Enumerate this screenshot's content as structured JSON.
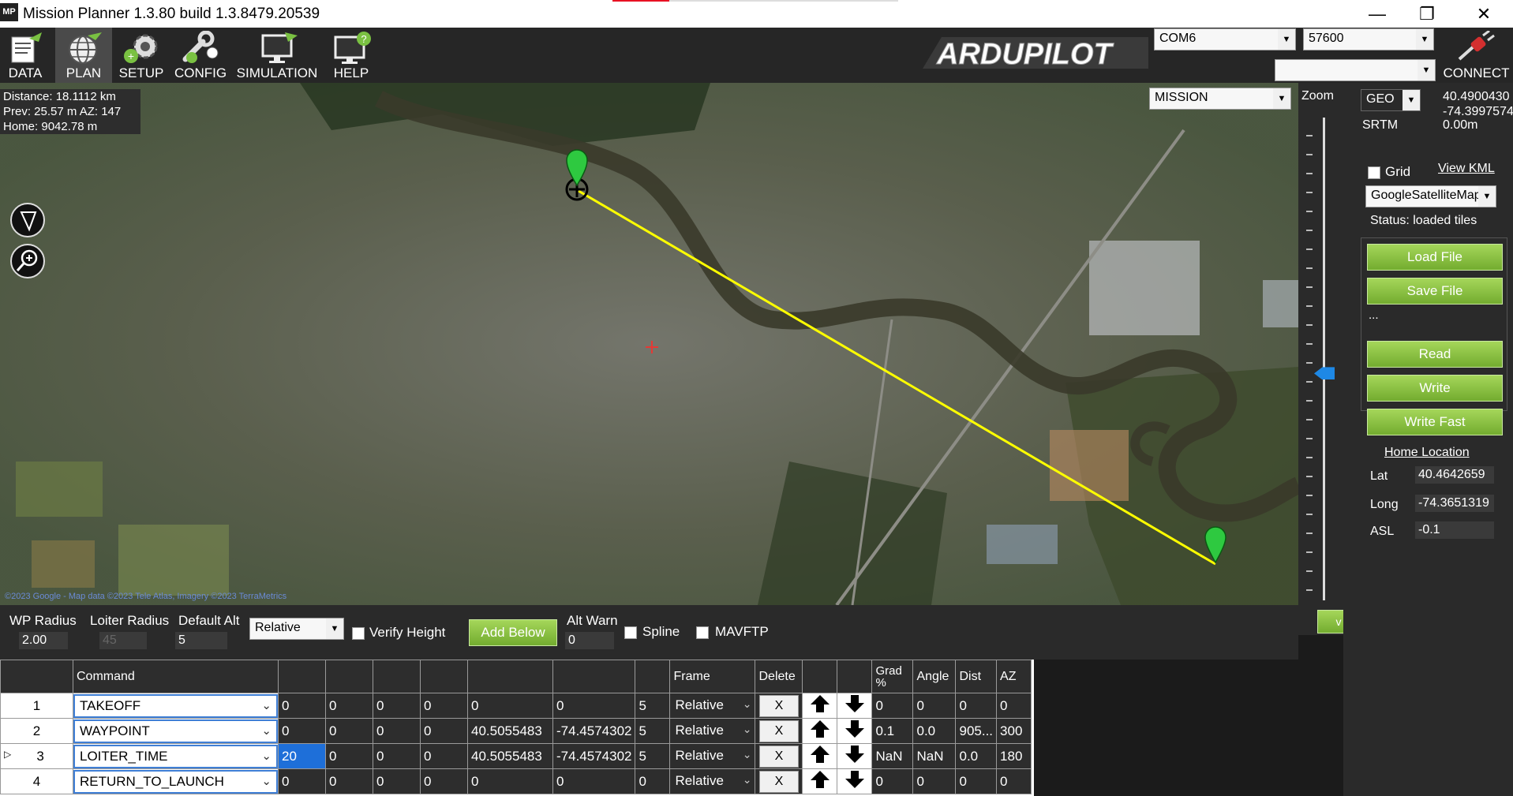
{
  "window": {
    "title": "Mission Planner 1.3.80 build 1.3.8479.20539",
    "app_icon": "MP",
    "controls": {
      "minimize": "—",
      "restore": "❐",
      "close": "✕"
    }
  },
  "toolbar": {
    "items": [
      {
        "label": "DATA",
        "icon": "data-icon"
      },
      {
        "label": "PLAN",
        "icon": "globe-icon",
        "active": true
      },
      {
        "label": "SETUP",
        "icon": "setup-gear-icon"
      },
      {
        "label": "CONFIG",
        "icon": "wrench-icon"
      },
      {
        "label": "SIMULATION",
        "icon": "monitor-plane-icon"
      },
      {
        "label": "HELP",
        "icon": "monitor-help-icon"
      }
    ],
    "logo_text": "ARDUPILOT",
    "port": "COM6",
    "baud": "57600",
    "link_combo": "",
    "connect_label": "CONNECT"
  },
  "map": {
    "info": {
      "distance": "Distance: 18.1112 km",
      "prev": "Prev: 25.57 m AZ: 147",
      "home": "Home: 9042.78 m"
    },
    "mode_combo": "MISSION",
    "attribution": "©2023 Google - Map data ©2023 Tele Atlas, Imagery ©2023 TerraMetrics"
  },
  "zoom": {
    "label": "Zoom",
    "level_fraction": 0.47,
    "collapse_button": "v"
  },
  "right": {
    "coord_mode": "GEO",
    "lat_readout": "40.4900430",
    "lng_readout": "-74.3997574",
    "srtm_label": "SRTM",
    "srtm_value": "0.00m",
    "grid_label": "Grid",
    "view_kml": "View KML",
    "map_type": "GoogleSatelliteMap",
    "status": "Status: loaded tiles",
    "load_file": "Load File",
    "save_file": "Save File",
    "ellipsis": "...",
    "read": "Read",
    "write": "Write",
    "write_fast": "Write Fast",
    "home_location": "Home Location",
    "lat_label": "Lat",
    "lat_value": "40.4642659",
    "long_label": "Long",
    "long_value": "-74.3651319",
    "asl_label": "ASL",
    "asl_value": "-0.1"
  },
  "options": {
    "wp_radius_label": "WP Radius",
    "wp_radius": "2.00",
    "loiter_radius_label": "Loiter Radius",
    "loiter_radius": "45",
    "default_alt_label": "Default Alt",
    "default_alt": "5",
    "alt_frame": "Relative",
    "verify_height": "Verify Height",
    "add_below": "Add Below",
    "alt_warn_label": "Alt Warn",
    "alt_warn": "0",
    "spline": "Spline",
    "mavftp": "MAVFTP"
  },
  "table": {
    "headers": {
      "command": "Command",
      "frame": "Frame",
      "delete": "Delete",
      "grad": "Grad %",
      "angle": "Angle",
      "dist": "Dist",
      "az": "AZ"
    },
    "rows": [
      {
        "num": "1",
        "command": "TAKEOFF",
        "p1": "0",
        "p2": "0",
        "p3": "0",
        "p4": "0",
        "lat": "0",
        "lng": "0",
        "alt": "5",
        "frame": "Relative",
        "delete": "X",
        "grad": "0",
        "angle": "0",
        "dist": "0",
        "az": "0"
      },
      {
        "num": "2",
        "command": "WAYPOINT",
        "p1": "0",
        "p2": "0",
        "p3": "0",
        "p4": "0",
        "lat": "40.5055483",
        "lng": "-74.4574302",
        "alt": "5",
        "frame": "Relative",
        "delete": "X",
        "grad": "0.1",
        "angle": "0.0",
        "dist": "905...",
        "az": "300"
      },
      {
        "num": "3",
        "command": "LOITER_TIME",
        "p1": "20",
        "p2": "0",
        "p3": "0",
        "p4": "0",
        "lat": "40.5055483",
        "lng": "-74.4574302",
        "alt": "5",
        "frame": "Relative",
        "delete": "X",
        "grad": "NaN",
        "angle": "NaN",
        "dist": "0.0",
        "az": "180",
        "current": true
      },
      {
        "num": "4",
        "command": "RETURN_TO_LAUNCH",
        "p1": "0",
        "p2": "0",
        "p3": "0",
        "p4": "0",
        "lat": "0",
        "lng": "0",
        "alt": "0",
        "frame": "Relative",
        "delete": "X",
        "grad": "0",
        "angle": "0",
        "dist": "0",
        "az": "0"
      }
    ]
  }
}
